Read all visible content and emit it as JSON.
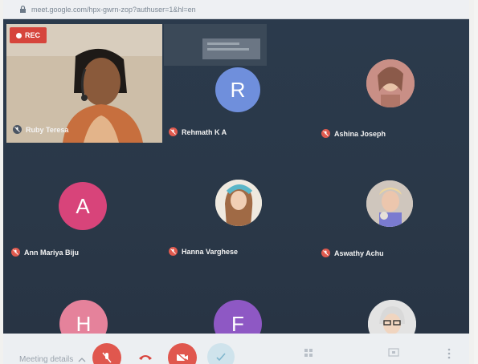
{
  "browser": {
    "url": "meet.google.com/hpx-gwrn-zop?authuser=1&hl=en"
  },
  "recording": {
    "label": "REC"
  },
  "participants": [
    {
      "name": "Ruby Teresa",
      "type": "video"
    },
    {
      "name": "Rehmath K A",
      "initial": "R",
      "color": "#6f8fdc"
    },
    {
      "name": "Ashina Joseph",
      "type": "photo"
    },
    {
      "name": "Ann Mariya Biju",
      "initial": "A",
      "color": "#d8447a"
    },
    {
      "name": "Hanna Varghese",
      "type": "photo"
    },
    {
      "name": "Aswathy Achu",
      "type": "photo"
    },
    {
      "initial": "H",
      "color": "#e5829b"
    },
    {
      "initial": "F",
      "color": "#8e58c4"
    },
    {
      "type": "photo"
    }
  ],
  "bottom_bar": {
    "meeting_label": "Meeting details"
  },
  "colors": {
    "grid_bg": "#2a3a4b",
    "mute_red": "#e05a4e",
    "rec_red": "#d6453c",
    "end_call_red": "#d9453e"
  }
}
